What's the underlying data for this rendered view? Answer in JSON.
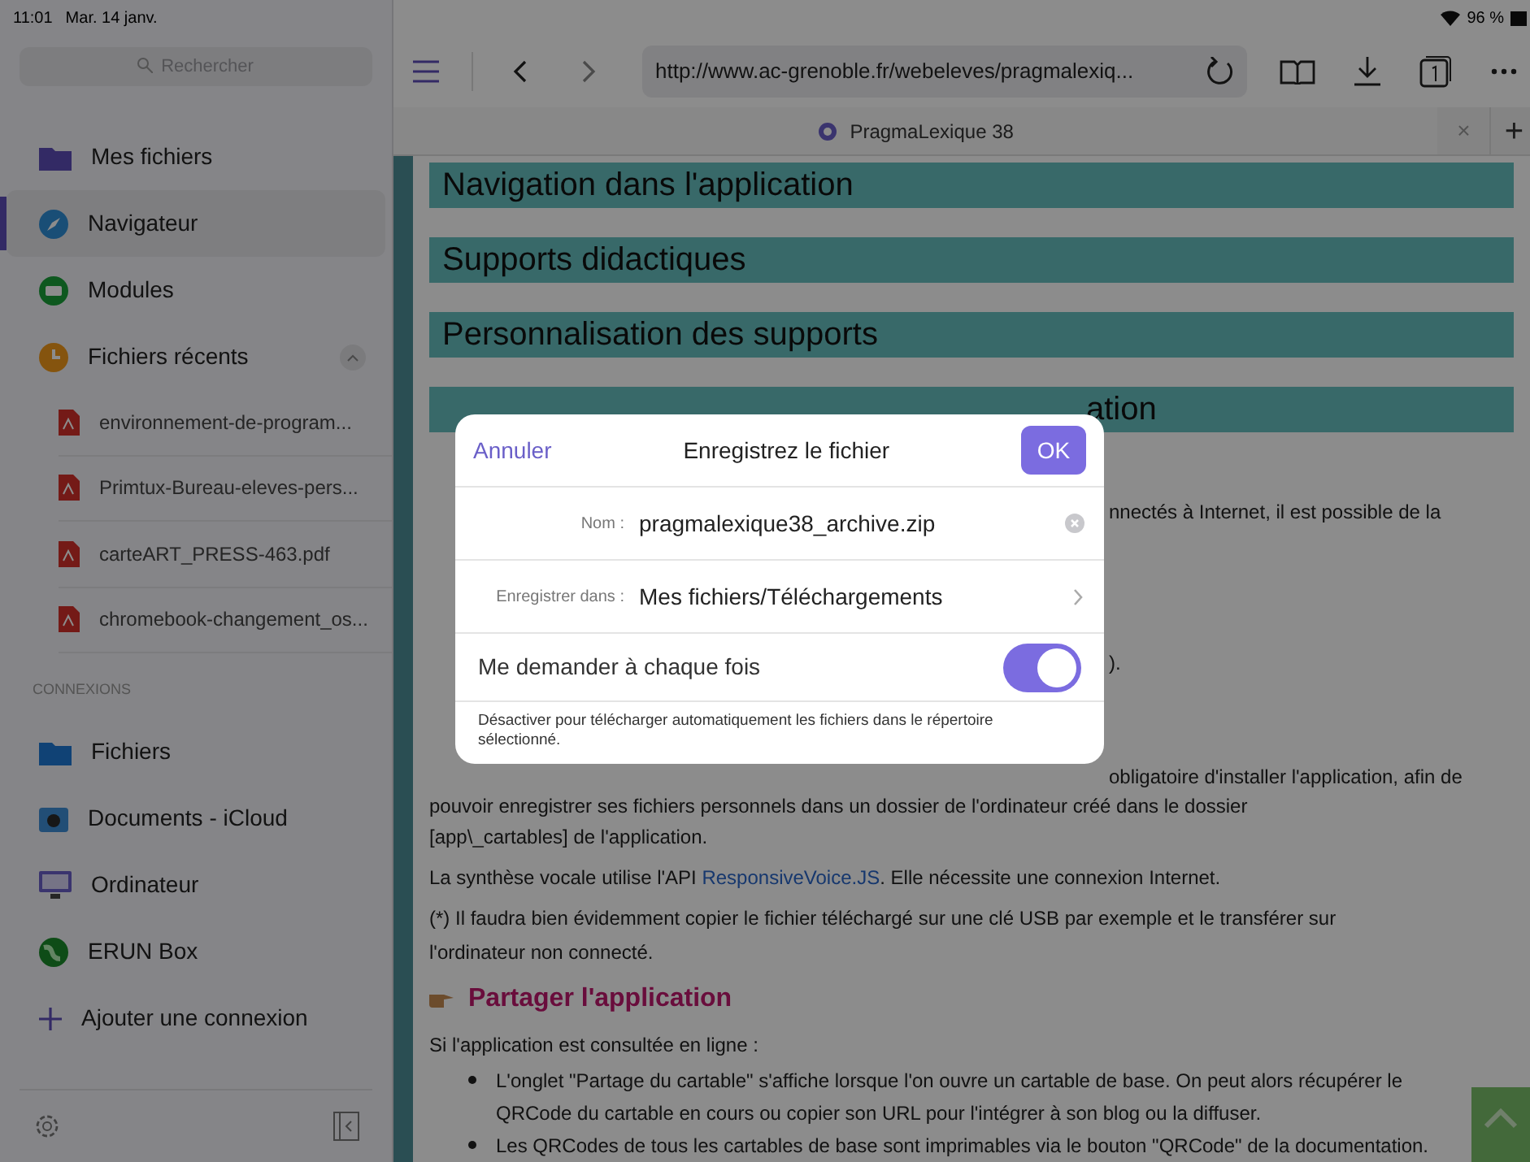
{
  "status_bar": {
    "time": "11:01",
    "date": "Mar. 14 janv.",
    "battery": "96 %"
  },
  "sidebar": {
    "search": {
      "placeholder": "Rechercher"
    },
    "items": [
      {
        "label": "Mes fichiers",
        "kind": "folder",
        "selected": false
      },
      {
        "label": "Navigateur",
        "kind": "compass",
        "selected": true
      },
      {
        "label": "Modules",
        "kind": "modules",
        "selected": false
      },
      {
        "label": "Fichiers récents",
        "kind": "clock",
        "selected": false,
        "expanded": true,
        "children": [
          {
            "label": "environnement-de-program..."
          },
          {
            "label": "Primtux-Bureau-eleves-pers..."
          },
          {
            "label": "carteART_PRESS-463.pdf"
          },
          {
            "label": "chromebook-changement_os..."
          }
        ]
      }
    ],
    "connections_header": "CONNEXIONS",
    "connections": [
      {
        "label": "Fichiers",
        "kind": "folder-blue"
      },
      {
        "label": "Documents - iCloud",
        "kind": "docs"
      },
      {
        "label": "Ordinateur",
        "kind": "computer"
      },
      {
        "label": "ERUN Box",
        "kind": "globe"
      },
      {
        "label": "Ajouter une connexion",
        "kind": "add"
      }
    ]
  },
  "browser": {
    "url": "http://www.ac-grenoble.fr/webeleves/pragmalexiq...",
    "tab": {
      "title": "PragmaLexique 38",
      "close": "×"
    },
    "new_tab": "+",
    "page": {
      "headings": [
        "Navigation dans l'application",
        "Supports didactiques",
        "Personnalisation des supports"
      ],
      "covered_heading": "ation",
      "fragments": [
        "nnectés à Internet, il est possible de la",
        ").",
        "obligatoire d'installer l'application, afin de"
      ],
      "paragraph": "pouvoir enregistrer ses fichiers personnels dans un dossier de l'ordinateur créé dans le dossier [app\\_cartables] de l'application.",
      "voice": {
        "before": "La synthèse vocale utilise l'API ",
        "link": "ResponsiveVoice.JS",
        "after": ". Elle nécessite une connexion Internet."
      },
      "note": "(*) Il faudra bien évidemment copier le fichier téléchargé sur une clé USB par exemple et le transférer sur l'ordinateur non connecté.",
      "section_title": "Partager l'application",
      "intro": "Si l'application est consultée en ligne :",
      "bullets": [
        "L'onglet \"Partage du cartable\" s'affiche lorsque l'on ouvre un cartable de base. On peut alors récupérer le QRCode du cartable en cours ou copier son URL pour l'intégrer à son blog ou la diffuser.",
        "Les QRCodes de tous les cartables de base sont imprimables via le bouton \"QRCode\" de la documentation."
      ]
    }
  },
  "dialog": {
    "cancel": "Annuler",
    "title": "Enregistrez le fichier",
    "ok": "OK",
    "name_label": "Nom :",
    "name_value": "pragmalexique38_archive.zip",
    "folder_label": "Enregistrer dans :",
    "folder_value": "Mes fichiers/Téléchargements",
    "ask_each_time": {
      "label": "Me demander à chaque fois",
      "on": true
    },
    "hint": "Désactiver pour télécharger automatiquement les fichiers dans le répertoire sélectionné."
  }
}
